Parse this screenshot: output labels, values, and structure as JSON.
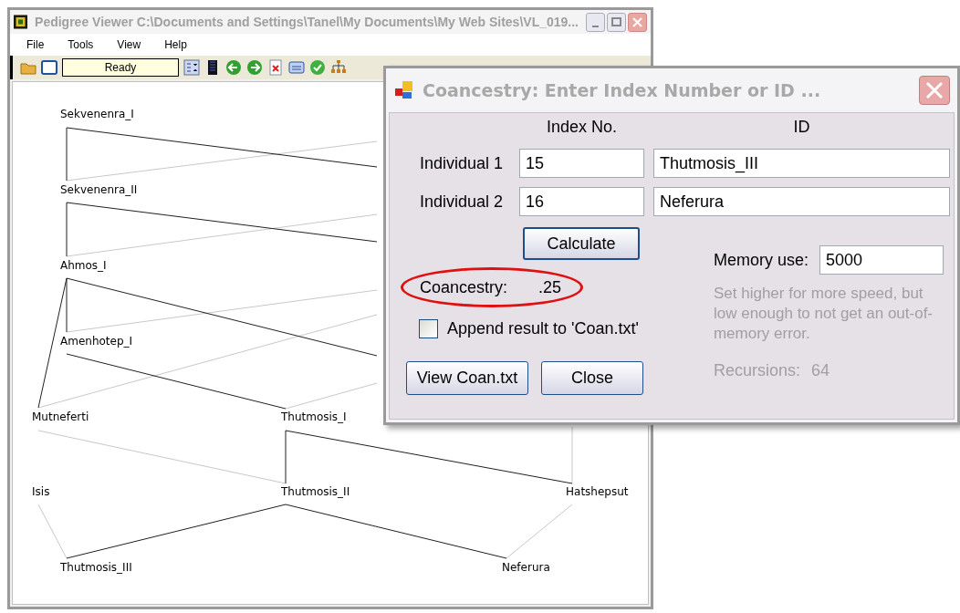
{
  "window": {
    "title": "Pedigree Viewer  C:\\Documents and Settings\\Tanel\\My Documents\\My Web Sites\\VL_019..."
  },
  "menu": [
    "File",
    "Tools",
    "View",
    "Help"
  ],
  "toolbar": {
    "status": "Ready"
  },
  "pedigree": {
    "nodes": [
      {
        "name": "Sekvenenra_I"
      },
      {
        "name": "Sekvenenra_II"
      },
      {
        "name": "Ahmos_I"
      },
      {
        "name": "Amenhotep_I"
      },
      {
        "name": "Mutneferti"
      },
      {
        "name": "Thutmosis_I"
      },
      {
        "name": "Isis"
      },
      {
        "name": "Thutmosis_II"
      },
      {
        "name": "Hatshepsut"
      },
      {
        "name": "Thutmosis_III"
      },
      {
        "name": "Neferura"
      }
    ]
  },
  "dialog": {
    "title": "Coancestry: Enter Index Number or ID ...",
    "columns": [
      "Index No.",
      "ID"
    ],
    "rows": [
      {
        "label": "Individual 1",
        "index": "15",
        "id": "Thutmosis_III"
      },
      {
        "label": "Individual 2",
        "index": "16",
        "id": "Neferura"
      }
    ],
    "calculate": "Calculate",
    "result": {
      "label": "Coancestry:",
      "value": ".25",
      "circled": true
    },
    "append": {
      "label": "Append result to 'Coan.txt'",
      "checked": false
    },
    "buttons": [
      "View Coan.txt",
      "Close"
    ],
    "memory": {
      "label": "Memory use:",
      "value": "5000"
    },
    "hint": "Set higher for more speed, but low enough to not get an out-of-memory error.",
    "recursions": {
      "label": "Recursions:",
      "value": "64"
    }
  }
}
